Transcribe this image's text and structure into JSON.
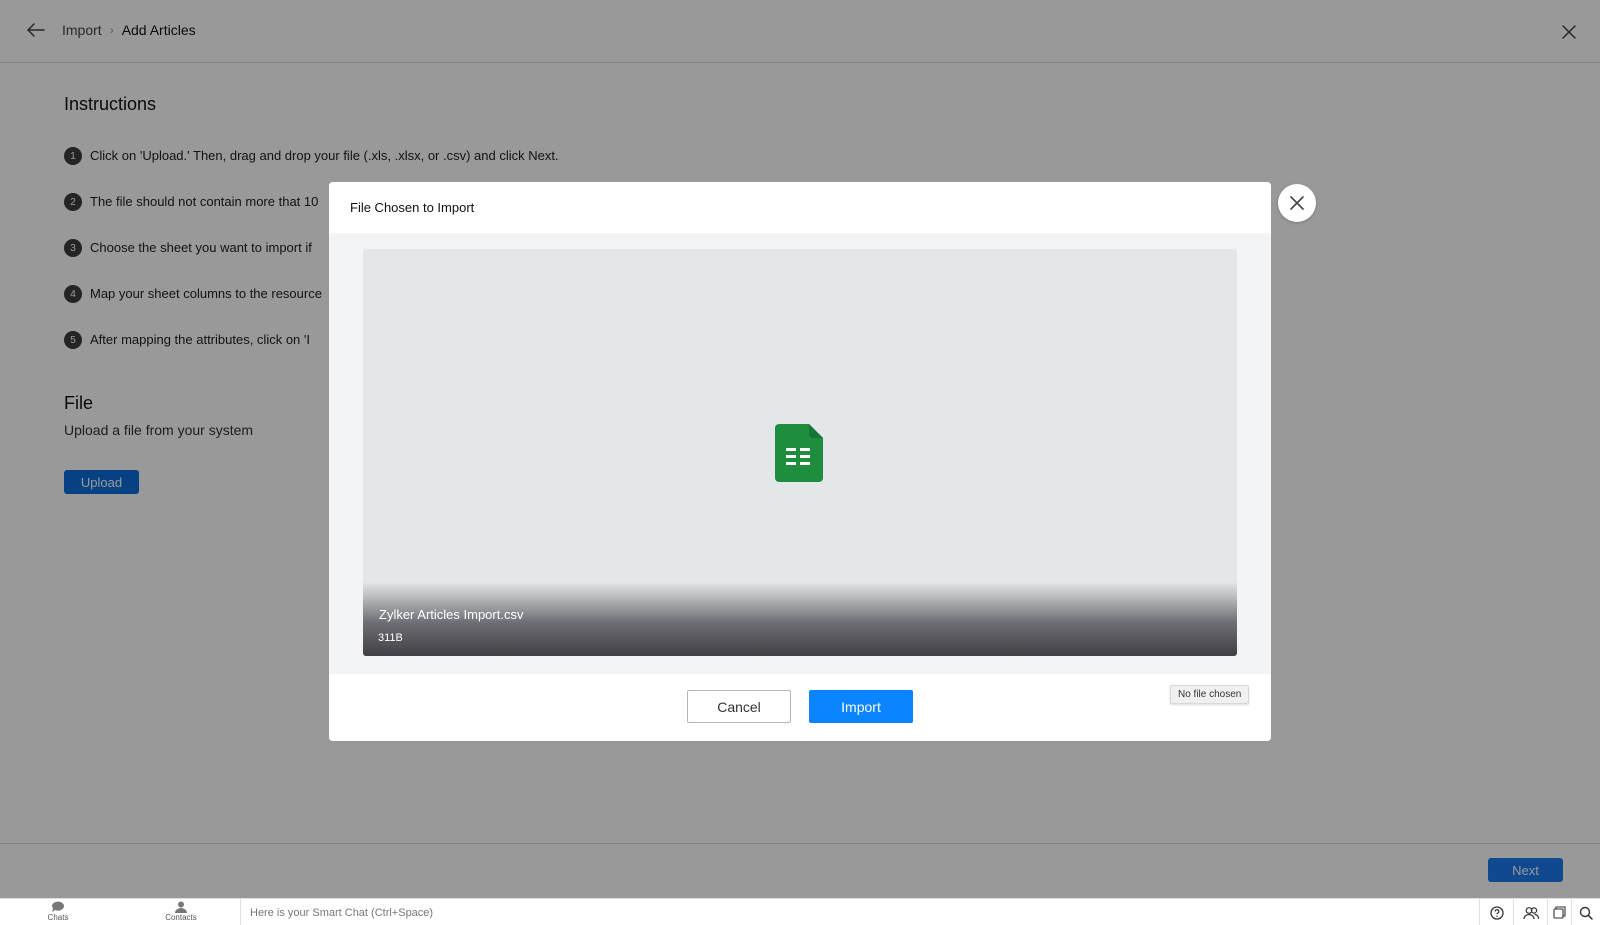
{
  "breadcrumb": {
    "parent": "Import",
    "separator": "›",
    "current": "Add Articles"
  },
  "instructions": {
    "title": "Instructions",
    "steps": [
      {
        "num": "1",
        "text": "Click on 'Upload.' Then, drag and drop your file (.xls, .xlsx, or .csv) and click Next."
      },
      {
        "num": "2",
        "text": "The file should not contain more that 10"
      },
      {
        "num": "3",
        "text": "Choose the sheet you want to import if"
      },
      {
        "num": "4",
        "text": "Map your sheet columns to the resource"
      },
      {
        "num": "5",
        "text": "After mapping the attributes, click on 'I"
      }
    ]
  },
  "file_section": {
    "title": "File",
    "subtitle": "Upload a file from your system",
    "upload_label": "Upload"
  },
  "footer": {
    "next_label": "Next"
  },
  "modal": {
    "title": "File Chosen to Import",
    "file_name": "Zylker Articles Import.csv",
    "file_size": "311B",
    "cancel_label": "Cancel",
    "import_label": "Import",
    "file_input_status": "No file chosen",
    "icon": "spreadsheet-file-icon"
  },
  "chatbar": {
    "chats_label": "Chats",
    "contacts_label": "Contacts",
    "smart_chat_placeholder": "Here is your Smart Chat (Ctrl+Space)"
  },
  "colors": {
    "primary_blue": "#0a84ff",
    "upload_blue": "#0a6fdb",
    "sheet_green": "#1e8e3e"
  }
}
